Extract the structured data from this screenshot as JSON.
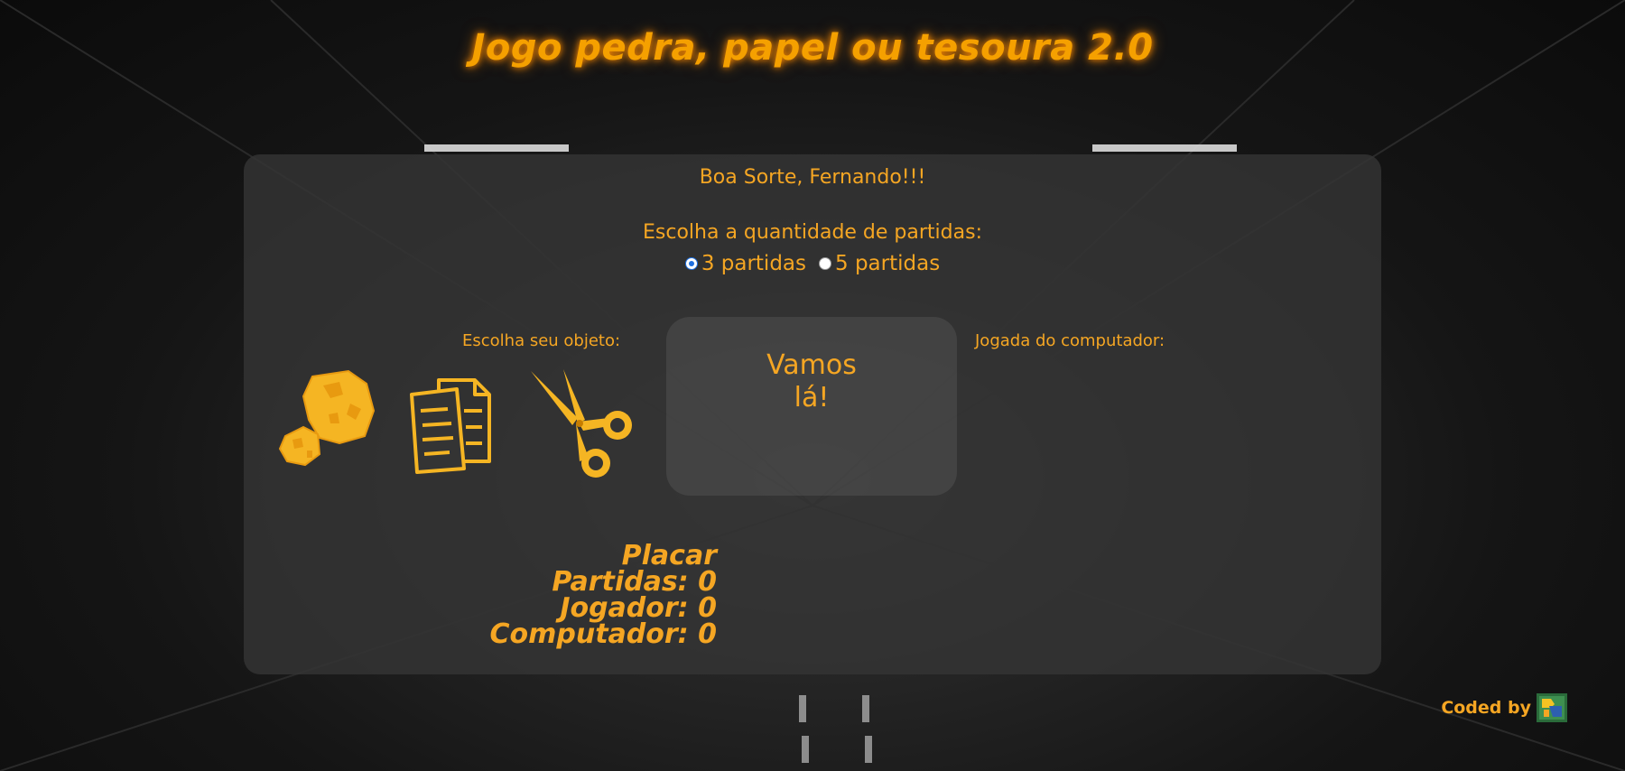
{
  "title": "Jogo pedra, papel ou tesoura 2.0",
  "greeting": "Boa Sorte, Fernando!!!",
  "matches": {
    "prompt": "Escolha a quantidade de partidas:",
    "options": [
      {
        "label": "3 partidas",
        "selected": true
      },
      {
        "label": "5 partidas",
        "selected": false
      }
    ]
  },
  "player": {
    "prompt": "Escolha seu objeto:",
    "objects": [
      "rock-icon",
      "paper-icon",
      "scissors-icon"
    ]
  },
  "computer": {
    "prompt": "Jogada do computador:"
  },
  "result": {
    "line1": "Vamos",
    "line2": "lá!"
  },
  "score": {
    "title": "Placar",
    "matches": "Partidas: 0",
    "player": "Jogador: 0",
    "computer": "Computador: 0"
  },
  "footer": {
    "text": "Coded by"
  },
  "colors": {
    "accent": "#f5a623",
    "glow": "#ff8c00",
    "panel": "#343434"
  }
}
